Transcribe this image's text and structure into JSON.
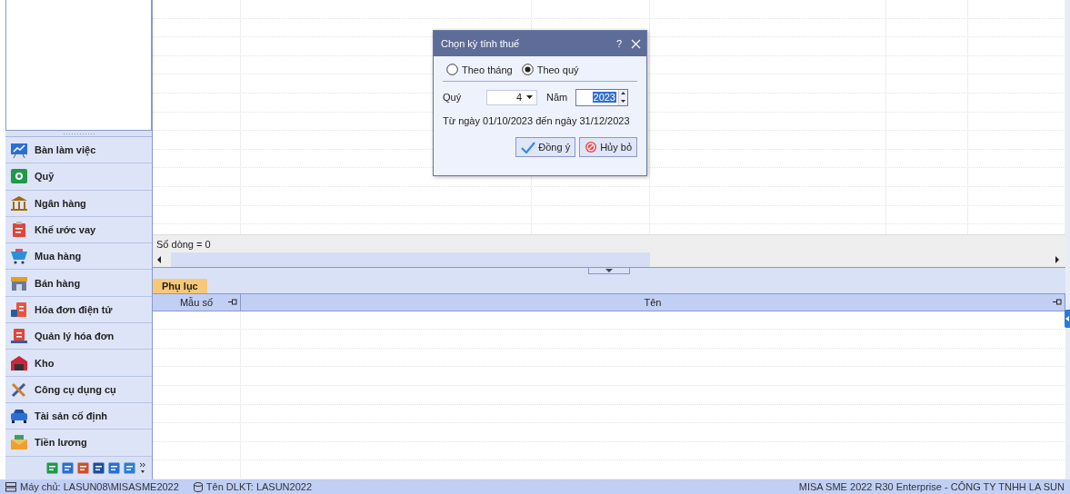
{
  "sidebar": {
    "items": [
      {
        "label": "Bàn làm việc",
        "selected": false
      },
      {
        "label": "Quỹ",
        "selected": false
      },
      {
        "label": "Ngân hàng",
        "selected": false
      },
      {
        "label": "Khế ước vay",
        "selected": false
      },
      {
        "label": "Mua hàng",
        "selected": false
      },
      {
        "label": "Bán hàng",
        "selected": false
      },
      {
        "label": "Hóa đơn điện tử",
        "selected": false
      },
      {
        "label": "Quản lý hóa đơn",
        "selected": false
      },
      {
        "label": "Kho",
        "selected": false
      },
      {
        "label": "Công cụ dụng cụ",
        "selected": false
      },
      {
        "label": "Tài sản cố định",
        "selected": false
      },
      {
        "label": "Tiền lương",
        "selected": false
      }
    ]
  },
  "grid": {
    "row_count": "Số dòng = 0"
  },
  "bottom_panel": {
    "tabs": [
      {
        "label": "Phụ lục",
        "selected": true
      }
    ],
    "columns": [
      "Mẫu số",
      "Tên"
    ]
  },
  "dialog": {
    "title": "Chọn kỳ tính thuế",
    "help": "?",
    "radios": [
      {
        "label": "Theo tháng",
        "selected": false
      },
      {
        "label": "Theo quý",
        "selected": true
      }
    ],
    "quarter_label": "Quý",
    "quarter_value": "4",
    "year_label": "Năm",
    "year_value": "2023",
    "range_text": "Từ ngày 01/10/2023 đến ngày 31/12/2023",
    "buttons": [
      {
        "label": "Đồng ý",
        "kind": "ok"
      },
      {
        "label": "Hủy bỏ",
        "kind": "cancel"
      }
    ]
  },
  "status_bar": {
    "server": "Máy chủ: LASUN08\\MISASME2022",
    "database": "Tên DLKT: LASUN2022",
    "product": "MISA SME 2022 R30 Enterprise - CÔNG TY TNHH LA SUN"
  }
}
